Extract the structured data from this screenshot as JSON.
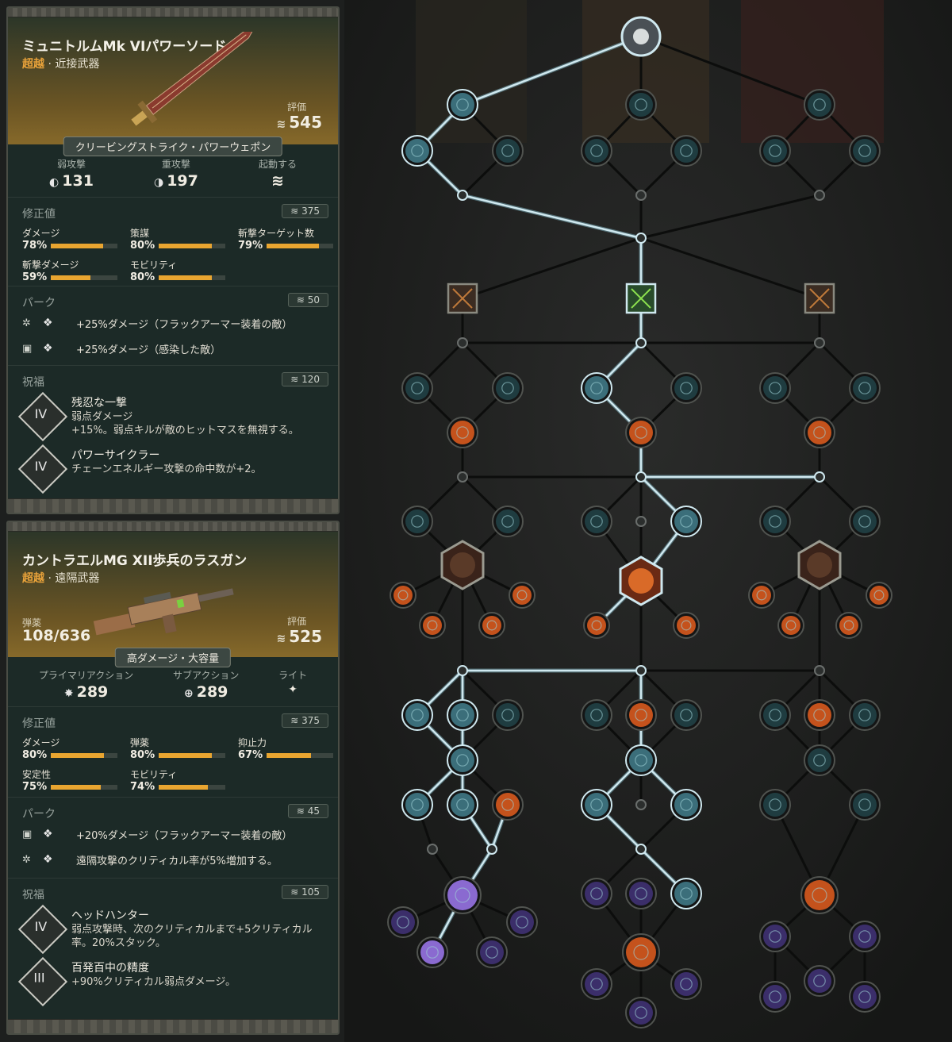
{
  "melee": {
    "name": "ミュニトルムMk VIパワーソード",
    "tier": "超越",
    "type_sep": " · ",
    "type": "近接武器",
    "rating_label": "評価",
    "rating": "545",
    "pattern": "クリービングストライク・パワーウェポン",
    "stats": [
      {
        "label": "弱攻撃",
        "value": "131",
        "icon": "light-attack-icon"
      },
      {
        "label": "重攻撃",
        "value": "197",
        "icon": "heavy-attack-icon"
      },
      {
        "label": "起動する",
        "value": "",
        "icon": "activate-icon"
      }
    ],
    "modifiers_title": "修正値",
    "modifiers_badge": "375",
    "modifiers": [
      {
        "label": "ダメージ",
        "value": "78%",
        "fill": 0.78
      },
      {
        "label": "策謀",
        "value": "80%",
        "fill": 0.8
      },
      {
        "label": "斬撃ターゲット数",
        "value": "79%",
        "fill": 0.79
      },
      {
        "label": "斬撃ダメージ",
        "value": "59%",
        "fill": 0.59
      },
      {
        "label": "モビリティ",
        "value": "80%",
        "fill": 0.8
      }
    ],
    "perks_title": "パーク",
    "perks_badge": "50",
    "perks": [
      {
        "icon": "gear-icon",
        "text": "+25%ダメージ（フラックアーマー装着の敵）"
      },
      {
        "icon": "lock-icon",
        "text": "+25%ダメージ（感染した敵）"
      }
    ],
    "blessings_title": "祝福",
    "blessings_badge": "120",
    "blessings": [
      {
        "tier": "IV",
        "name": "残忍な一撃",
        "desc": "弱点ダメージ\n+15%。弱点キルが敵のヒットマスを無視する。"
      },
      {
        "tier": "IV",
        "name": "パワーサイクラー",
        "desc": "チェーンエネルギー攻撃の命中数が+2。"
      }
    ]
  },
  "ranged": {
    "name": "カントラエルMG XII歩兵のラスガン",
    "tier": "超越",
    "type_sep": " · ",
    "type": "遠隔武器",
    "ammo_label": "弾薬",
    "ammo": "108/636",
    "rating_label": "評価",
    "rating": "525",
    "pattern": "高ダメージ・大容量",
    "stats": [
      {
        "label": "プライマリアクション",
        "value": "289",
        "icon": "primary-action-icon"
      },
      {
        "label": "サブアクション",
        "value": "289",
        "icon": "crosshair-icon"
      },
      {
        "label": "ライト",
        "value": "",
        "icon": "flashlight-icon"
      }
    ],
    "modifiers_title": "修正値",
    "modifiers_badge": "375",
    "modifiers": [
      {
        "label": "ダメージ",
        "value": "80%",
        "fill": 0.8
      },
      {
        "label": "弾薬",
        "value": "80%",
        "fill": 0.8
      },
      {
        "label": "抑止力",
        "value": "67%",
        "fill": 0.67
      },
      {
        "label": "安定性",
        "value": "75%",
        "fill": 0.75
      },
      {
        "label": "モビリティ",
        "value": "74%",
        "fill": 0.74
      }
    ],
    "perks_title": "パーク",
    "perks_badge": "45",
    "perks": [
      {
        "icon": "lock-icon",
        "text": "+20%ダメージ（フラックアーマー装着の敵）"
      },
      {
        "icon": "gear-icon",
        "text": "遠隔攻撃のクリティカル率が5%増加する。"
      }
    ],
    "blessings_title": "祝福",
    "blessings_badge": "105",
    "blessings": [
      {
        "tier": "IV",
        "name": "ヘッドハンター",
        "desc": "弱点攻撃時、次のクリティカルまで+5クリティカル率。20%スタック。"
      },
      {
        "tier": "III",
        "name": "百発百中の精度",
        "desc": "+90%クリティカル弱点ダメージ。"
      }
    ]
  },
  "colors": {
    "tier": "#e8a23a",
    "bar_fill": "#e9a530",
    "active_link": "#cfe8ef",
    "inactive_link": "#0c0d0c",
    "node_teal": "#2f6f78",
    "node_orange": "#c4521c",
    "node_purple": "#8a6ad0"
  }
}
